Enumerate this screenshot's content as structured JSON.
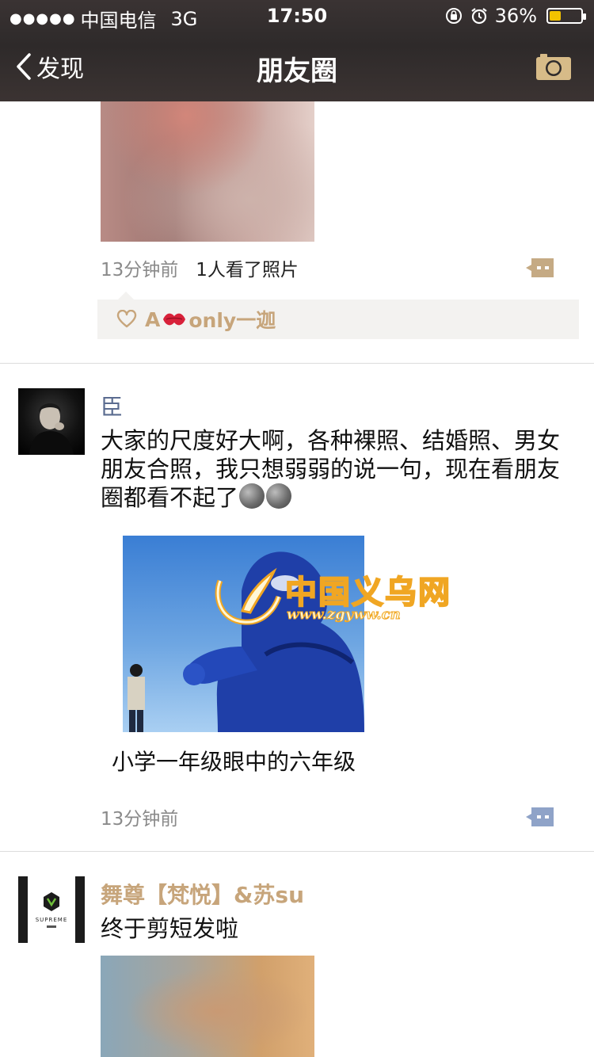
{
  "status_bar": {
    "signal_dots": "●●●●●",
    "carrier": "中国电信",
    "network": "3G",
    "time": "17:50",
    "battery_percent": "36%",
    "battery_level": 0.36,
    "battery_color": "#f3c200"
  },
  "nav": {
    "back_label": "发现",
    "title": "朋友圈",
    "camera_icon": "camera-icon"
  },
  "posts": [
    {
      "time": "13分钟前",
      "views": "1人看了照片",
      "likes": {
        "prefix": "A",
        "suffix": "only一迦"
      }
    },
    {
      "username": "臣",
      "text": "大家的尺度好大啊，各种裸照、结婚照、男女朋友合照，我只想弱弱的说一句，现在看朋友圈都看不起了",
      "image_caption": "小学一年级眼中的六年级",
      "time": "13分钟前",
      "watermark_title": "中国义乌网",
      "watermark_url": "www.zgyww.cn"
    },
    {
      "username": "舞尊【梵悦】&苏su",
      "text": "终于剪短发啦",
      "avatar_brand": "SUPREME"
    }
  ],
  "colors": {
    "header_bg": "#2e2a2a",
    "name_blue": "#5b6c90",
    "name_gold": "#c7a57b",
    "like_bg": "#f3f2f0"
  }
}
